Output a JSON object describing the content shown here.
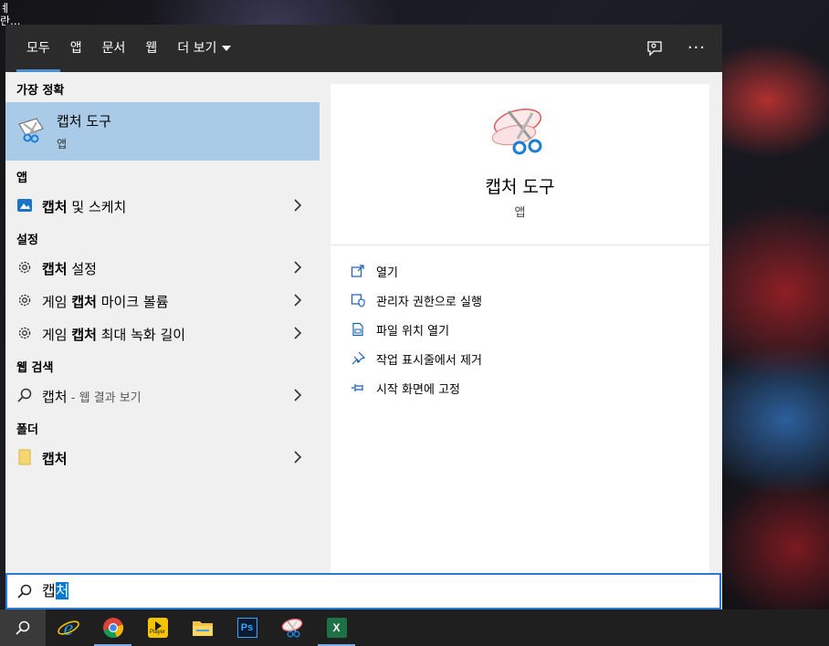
{
  "desktop": {
    "text_line1": "ㅖ",
    "text_line2": "란..."
  },
  "tabs": [
    {
      "label": "모두",
      "active": true
    },
    {
      "label": "앱"
    },
    {
      "label": "문서"
    },
    {
      "label": "웹"
    },
    {
      "label": "더 보기"
    }
  ],
  "topbar": {
    "feedback_icon": "feedback-icon",
    "more_label": "···"
  },
  "best_match": {
    "heading": "가장 정확",
    "title": "캡처 도구",
    "subtitle": "앱",
    "icon": "snipping-tool-icon"
  },
  "sections": {
    "apps": {
      "heading": "앱"
    },
    "settings": {
      "heading": "설정"
    },
    "web": {
      "heading": "웹 검색"
    },
    "folders": {
      "heading": "폴더"
    }
  },
  "results": {
    "app_snip_sketch": {
      "bold": "캡처",
      "rest": " 및 스케치",
      "icon": "snip-sketch-icon"
    },
    "setting_1": {
      "pre": "",
      "bold": "캡처",
      "rest": " 설정",
      "icon": "gear-icon"
    },
    "setting_2": {
      "pre": "게임 ",
      "bold": "캡처",
      "rest": " 마이크 볼륨",
      "icon": "gear-icon"
    },
    "setting_3": {
      "pre": "게임 ",
      "bold": "캡처",
      "rest": " 최대 녹화 길이",
      "icon": "gear-icon"
    },
    "web_1": {
      "main": "캡처",
      "hint": " - 웹 결과 보기",
      "icon": "search-icon"
    },
    "folder_1": {
      "bold": "캡처",
      "icon": "folder-icon"
    }
  },
  "preview": {
    "title": "캡처 도구",
    "subtitle": "앱",
    "actions": [
      {
        "label": "열기",
        "icon": "open-icon"
      },
      {
        "label": "관리자 권한으로 실행",
        "icon": "admin-shield-icon"
      },
      {
        "label": "파일 위치 열기",
        "icon": "file-location-icon"
      },
      {
        "label": "작업 표시줄에서 제거",
        "icon": "unpin-icon"
      },
      {
        "label": "시작 화면에 고정",
        "icon": "pin-icon"
      }
    ]
  },
  "search": {
    "typed": "캡",
    "selected": "처"
  },
  "taskbar": [
    {
      "name": "search",
      "icon": "search-icon"
    },
    {
      "name": "internet-explorer",
      "icon": "ie-icon"
    },
    {
      "name": "chrome",
      "icon": "chrome-icon",
      "open": true
    },
    {
      "name": "player",
      "icon": "player-icon",
      "label": "Player"
    },
    {
      "name": "file-explorer",
      "icon": "folder-icon"
    },
    {
      "name": "photoshop",
      "icon": "photoshop-icon",
      "label": "Ps"
    },
    {
      "name": "snipping-tool",
      "icon": "snipping-tool-icon"
    },
    {
      "name": "excel",
      "icon": "excel-icon",
      "label": "X"
    }
  ],
  "colors": {
    "accent": "#0078d7",
    "selected_row": "#a9cbe8",
    "topbar": "#2b2b2b",
    "menu_bg": "#f0f0f0"
  }
}
